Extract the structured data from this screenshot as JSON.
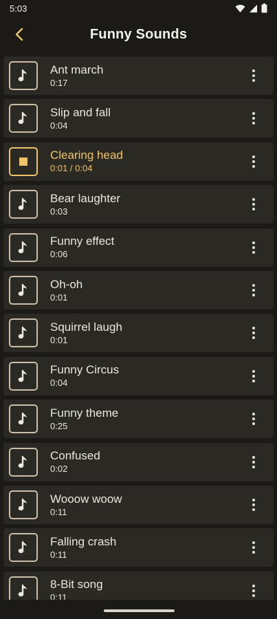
{
  "status_bar": {
    "time": "5:03",
    "icons": [
      "wifi-icon",
      "signal-icon",
      "battery-icon"
    ]
  },
  "app_bar": {
    "title": "Funny Sounds",
    "back_icon": "chevron-left-icon"
  },
  "colors": {
    "accent": "#f0c36a",
    "row_bg": "#2b2923",
    "background": "#1b1a16",
    "text": "#ece7dc"
  },
  "sounds": [
    {
      "name": "Ant march",
      "duration": "0:17",
      "playing": false
    },
    {
      "name": "Slip and fall",
      "duration": "0:04",
      "playing": false
    },
    {
      "name": "Clearing head",
      "duration": "0:01 / 0:04",
      "playing": true
    },
    {
      "name": "Bear laughter",
      "duration": "0:03",
      "playing": false
    },
    {
      "name": "Funny effect",
      "duration": "0:06",
      "playing": false
    },
    {
      "name": "Oh-oh",
      "duration": "0:01",
      "playing": false
    },
    {
      "name": "Squirrel laugh",
      "duration": "0:01",
      "playing": false
    },
    {
      "name": "Funny Circus",
      "duration": "0:04",
      "playing": false
    },
    {
      "name": "Funny theme",
      "duration": "0:25",
      "playing": false
    },
    {
      "name": "Confused",
      "duration": "0:02",
      "playing": false
    },
    {
      "name": "Wooow woow",
      "duration": "0:11",
      "playing": false
    },
    {
      "name": "Falling crash",
      "duration": "0:11",
      "playing": false
    },
    {
      "name": "8-Bit song",
      "duration": "0:11",
      "playing": false
    }
  ]
}
